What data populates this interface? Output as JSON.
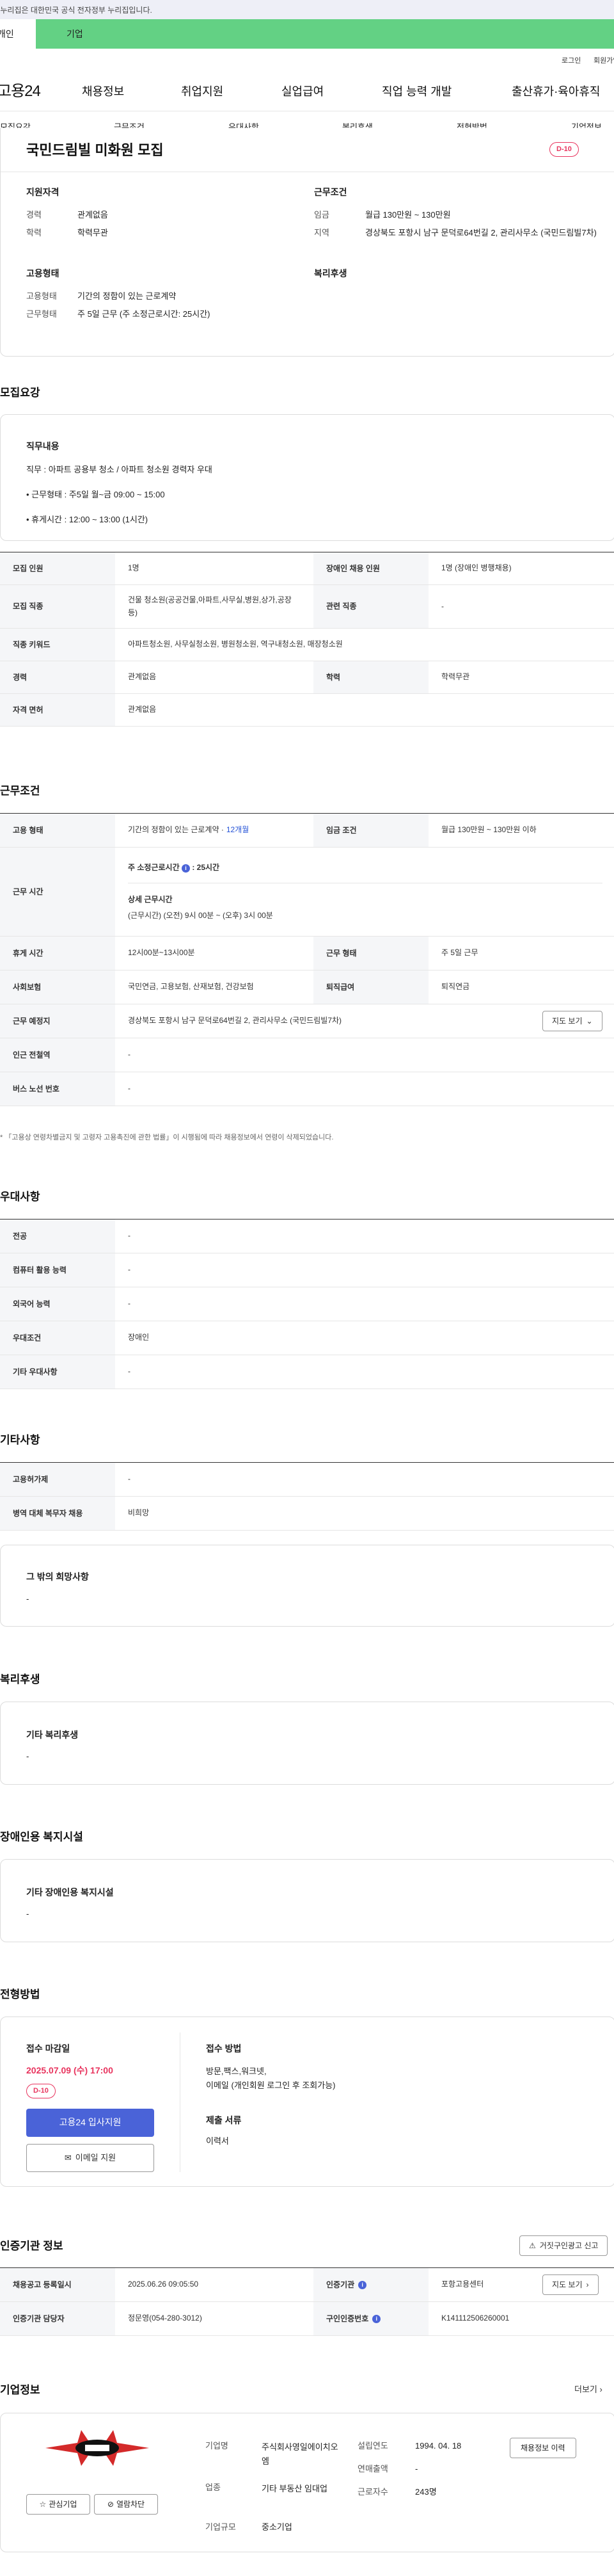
{
  "notice": "이 누리집은 대한민국 공식 전자정부 누리집입니다.",
  "member_tabs": [
    "개인",
    "기업"
  ],
  "util": {
    "login": "로그인",
    "join": "회원가입"
  },
  "gnb": {
    "logo": "고용24",
    "menu": [
      "채용정보",
      "취업지원",
      "실업급여",
      "직업 능력 개발",
      "출산휴가·육아휴직"
    ]
  },
  "anchors": [
    "모집요강",
    "근무조건",
    "우대사항",
    "복리후생",
    "전형방법",
    "기업정보"
  ],
  "summary": {
    "title": "국민드림빌 미화원 모집",
    "dday": "D-10",
    "qual_head": "지원자격",
    "cond_head": "근무조건",
    "qual": [
      {
        "k": "경력",
        "v": "관계없음"
      },
      {
        "k": "학력",
        "v": "학력무관"
      }
    ],
    "cond": [
      {
        "k": "임금",
        "v": "월급 130만원 ~ 130만원"
      },
      {
        "k": "지역",
        "v": "경상북도 포항시 남구 문덕로64번길 2, 관리사무소 (국민드림빌7차)"
      }
    ],
    "emp_head": "고용형태",
    "welfare_head": "복리후생",
    "emp": [
      {
        "k": "고용형태",
        "v": "기간의 정함이 있는 근로계약"
      },
      {
        "k": "근무형태",
        "v": "주 5일 근무 (주 소정근로시간: 25시간)"
      }
    ]
  },
  "recruit": {
    "title": "모집요강",
    "duty_head": "직무내용",
    "duty_lines": [
      "직무 : 아파트 공용부 청소 / 아파트 청소원 경력자 우대",
      "• 근무형태 : 주5일 월~금 09:00 ~ 15:00",
      "• 휴게시간 : 12:00 ~ 13:00 (1시간)"
    ],
    "rows": [
      {
        "k1": "모집 인원",
        "v1": "1명",
        "k2": "장애인 채용 인원",
        "v2": "1명 (장애인 병행채용)"
      },
      {
        "k1": "모집 직종",
        "v1": "건물 청소원(공공건물,아파트,사무실,병원,상가,공장 등)",
        "k2": "관련 직종",
        "v2": "-"
      },
      {
        "k1": "직종 키워드",
        "v1": "아파트청소원, 사무실청소원, 병원청소원, 역구내청소원, 매장청소원"
      },
      {
        "k1": "경력",
        "v1": "관계없음",
        "k2": "학력",
        "v2": "학력무관"
      },
      {
        "k1": "자격 면허",
        "v1": "관계없음"
      }
    ]
  },
  "work": {
    "title": "근무조건",
    "emp_type_k": "고용 형태",
    "emp_type_v": "기간의 정함이 있는 근로계약 · ",
    "emp_type_link": "12개월",
    "wage_k": "임금 조건",
    "wage_v": "월급 130만원 ~ 130만원 이하",
    "hours_k": "근무 시간",
    "hours_total": "주 소정근로시간",
    "hours_total_v": ": 25시간",
    "hours_detail_head": "상세 근무시간",
    "hours_detail": "(근무시간) (오전) 9시 00분 ~ (오후) 3시 00분",
    "break_k": "휴게 시간",
    "break_v": "12시00분~13시00분",
    "form_k": "근무 형태",
    "form_v": "주 5일 근무",
    "ins_k": "사회보험",
    "ins_v": "국민연금, 고용보험, 산재보험, 건강보험",
    "retire_k": "퇴직급여",
    "retire_v": "퇴직연금",
    "place_k": "근무 예정지",
    "place_v": "경상북도 포항시 남구 문덕로64번길 2, 관리사무소 (국민드림빌7차)",
    "map_btn": "지도 보기",
    "subway_k": "인근 전철역",
    "subway_v": "-",
    "bus_k": "버스 노선 번호",
    "bus_v": "-",
    "note": "「고용상 연령차별금지 및 고령자 고용촉진에 관한 법률」이 시행됨에 따라 채용정보에서 연령이 삭제되었습니다."
  },
  "pref": {
    "title": "우대사항",
    "rows": [
      {
        "k": "전공",
        "v": "-"
      },
      {
        "k": "컴퓨터 활용 능력",
        "v": "-"
      },
      {
        "k": "외국어 능력",
        "v": "-"
      },
      {
        "k": "우대조건",
        "v": "장애인"
      },
      {
        "k": "기타 우대사항",
        "v": "-"
      }
    ]
  },
  "etc": {
    "title": "기타사항",
    "rows": [
      {
        "k": "고용허가제",
        "v": "-"
      },
      {
        "k": "병역 대체 복무자 채용",
        "v": "비희망"
      }
    ],
    "other_head": "그 밖의 희망사항",
    "other_v": "-"
  },
  "welfare": {
    "title": "복리후생",
    "head": "기타 복리후생",
    "v": "-"
  },
  "disabled": {
    "title": "장애인용 복지시설",
    "head": "기타 장애인용 복지시설",
    "v": "-"
  },
  "selection": {
    "title": "전형방법",
    "deadline_head": "접수 마감일",
    "deadline": "2025.07.09 (수) 17:00",
    "dday": "D-10",
    "apply_btn": "고용24 입사지원",
    "email_btn": "이메일 지원",
    "method_head": "접수 방법",
    "method_v": "방문,팩스,워크넷,\n이메일 (개인회원 로그인 후 조회가능)",
    "docs_head": "제출 서류",
    "docs_v": "이력서"
  },
  "cert": {
    "title": "인증기관 정보",
    "report_btn": "거짓구인광고 신고",
    "rows": [
      {
        "k1": "채용공고 등록일시",
        "v1": "2025.06.26 09:05:50",
        "k2": "인증기관",
        "v2": "포항고용센터"
      },
      {
        "k1": "인증기관 담당자",
        "v1": "정문영(054-280-3012)",
        "k2": "구인인증번호",
        "v2": "K141112506260001"
      }
    ],
    "map_btn": "지도 보기"
  },
  "company": {
    "title": "기업정보",
    "more": "더보기",
    "fav_btn": "관심기업",
    "block_btn": "열람차단",
    "history_btn": "채용정보 이력",
    "name_k": "기업명",
    "name_v": "주식회사영일에이치오엠",
    "ind_k": "업종",
    "ind_v": "기타 부동산 임대업",
    "size_k": "기업규모",
    "size_v": "중소기업",
    "year_k": "설립연도",
    "year_v": "1994. 04. 18",
    "sales_k": "연매출액",
    "sales_v": "-",
    "emp_k": "근로자수",
    "emp_v": "243명"
  },
  "colors": {
    "accent": "#4a63d8",
    "dday": "#e8345e",
    "green": "#63d184"
  }
}
